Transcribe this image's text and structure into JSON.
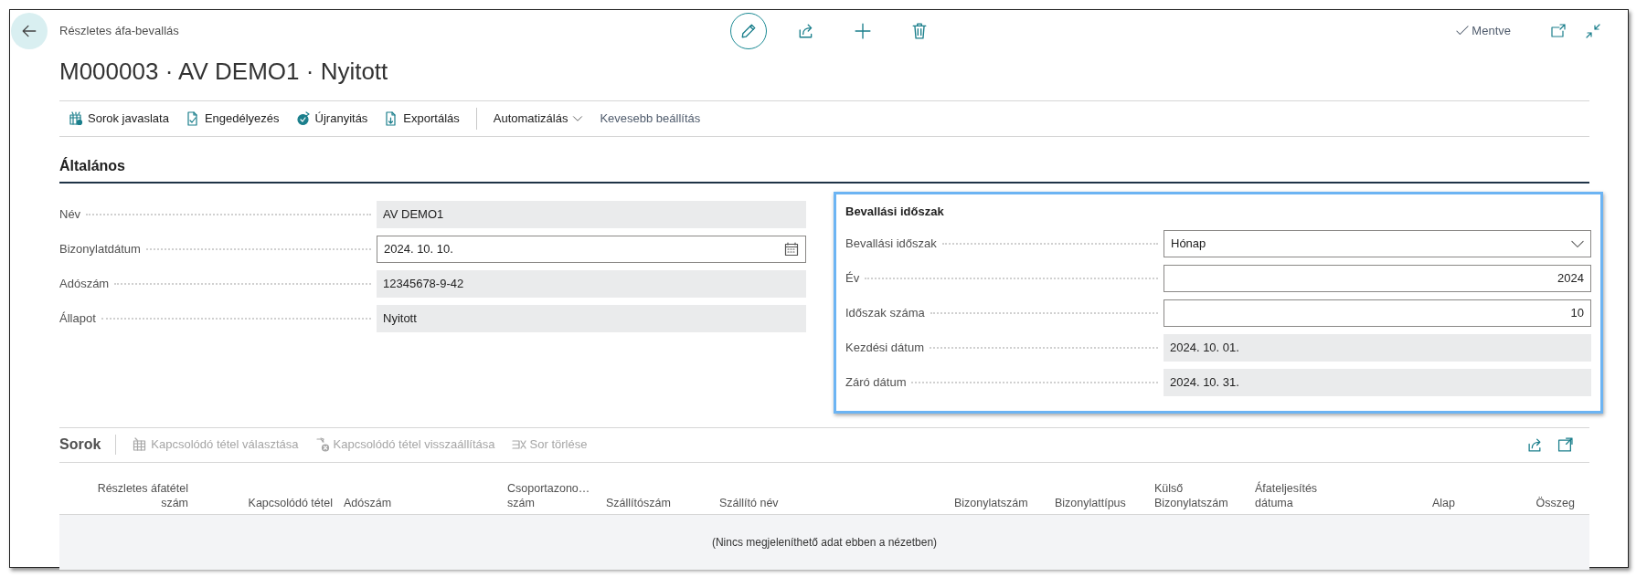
{
  "page": {
    "breadcrumb": "Részletes áfa-bevallás",
    "title": "M000003 · AV DEMO1 · Nyitott",
    "save_status": "Mentve"
  },
  "actions": [
    {
      "label": "Sorok javaslata",
      "kind": "suggest"
    },
    {
      "label": "Engedélyezés",
      "kind": "release"
    },
    {
      "label": "Újranyitás",
      "kind": "reopen"
    },
    {
      "label": "Exportálás",
      "kind": "export"
    },
    {
      "kind": "separator"
    },
    {
      "label": "Automatizálás",
      "kind": "menu"
    },
    {
      "label": "Kevesebb beállítás",
      "kind": "toggle"
    }
  ],
  "general": {
    "title": "Általános",
    "fields": [
      {
        "label": "Név",
        "value": "AV DEMO1",
        "kind": "readonly"
      },
      {
        "label": "Bizonylatdátum",
        "value": "2024. 10. 10.",
        "kind": "date"
      },
      {
        "label": "Adószám",
        "value": "12345678-9-42",
        "kind": "readonly"
      },
      {
        "label": "Állapot",
        "value": "Nyitott",
        "kind": "readonly"
      }
    ]
  },
  "period": {
    "title": "Bevallási időszak",
    "focused": true,
    "fields": [
      {
        "label": "Bevallási időszak",
        "value": "Hónap",
        "kind": "select"
      },
      {
        "label": "Év",
        "value": "2024",
        "kind": "number"
      },
      {
        "label": "Időszak száma",
        "value": "10",
        "kind": "number"
      },
      {
        "label": "Kezdési dátum",
        "value": "2024. 10. 01.",
        "kind": "readonly"
      },
      {
        "label": "Záró dátum",
        "value": "2024. 10. 31.",
        "kind": "readonly"
      }
    ]
  },
  "lines": {
    "title": "Sorok",
    "actions": [
      {
        "label": "Kapcsolódó tétel választása",
        "kind": "select",
        "disabled": true
      },
      {
        "label": "Kapcsolódó tétel visszaállítása",
        "kind": "reset",
        "disabled": true
      },
      {
        "label": "Sor törlése",
        "kind": "delete",
        "disabled": true
      }
    ],
    "columns": [
      "Részletes áfatétel\nszám",
      "Kapcsolódó tétel",
      "Adószám",
      "Csoportazono…\nszám",
      "Szállítószám",
      "Szállító név",
      "Bizonylatszám",
      "Bizonylattípus",
      "Külső\nBizonylatszám",
      "Áfateljesítés\ndátuma",
      "Alap",
      "Összeg"
    ],
    "empty_message": "(Nincs megjeleníthető adat ebben a nézetben)"
  }
}
